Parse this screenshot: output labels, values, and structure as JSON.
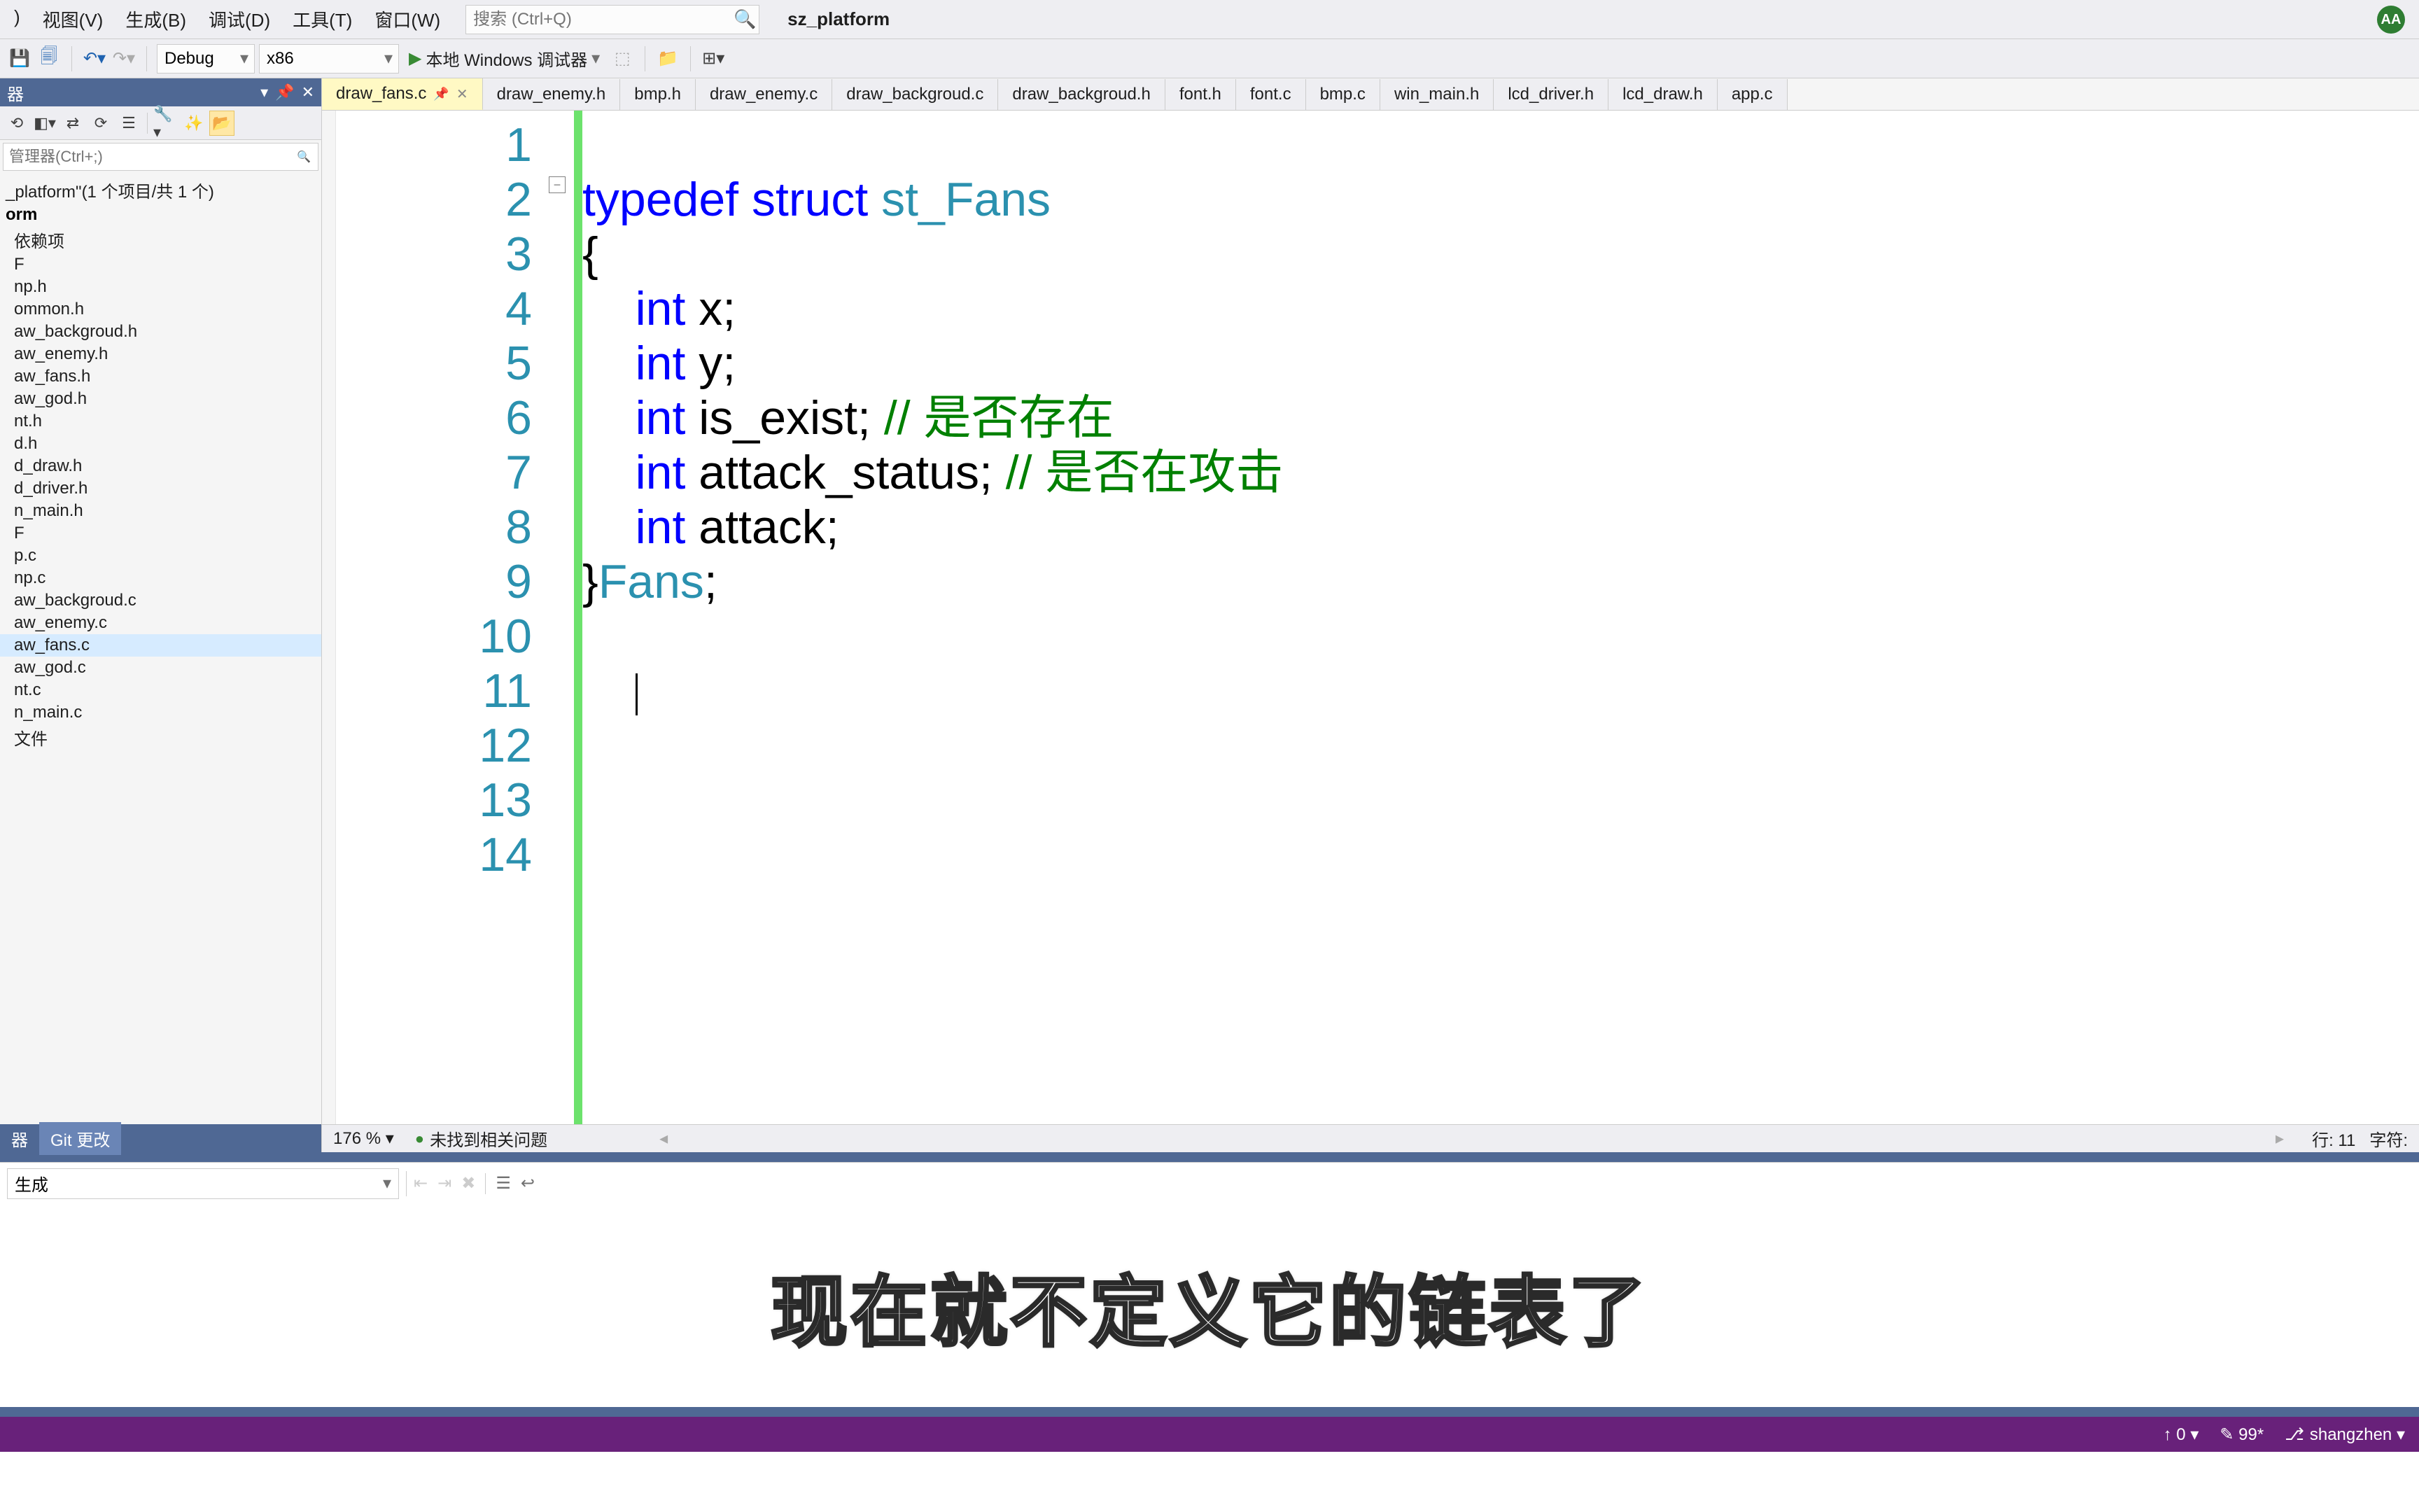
{
  "menubar": {
    "items": [
      ")",
      "视图(V)",
      "生成(B)",
      "调试(D)",
      "工具(T)",
      "窗口(W)"
    ],
    "search_placeholder": "搜索 (Ctrl+Q)",
    "project": "sz_platform",
    "avatar": "AA"
  },
  "toolbar": {
    "config": "Debug",
    "platform": "x86",
    "debugger": "本地 Windows 调试器"
  },
  "sidebar": {
    "header_title": "器",
    "search_placeholder": "管理器(Ctrl+;)",
    "solution": "_platform\"(1 个项目/共 1 个)",
    "project_bold": "orm",
    "items": [
      "依赖项",
      "F",
      "np.h",
      "ommon.h",
      "aw_backgroud.h",
      "aw_enemy.h",
      "aw_fans.h",
      "aw_god.h",
      "nt.h",
      "d.h",
      "d_draw.h",
      "d_driver.h",
      "n_main.h",
      "F",
      "p.c",
      "np.c",
      "aw_backgroud.c",
      "aw_enemy.c",
      "aw_fans.c",
      "aw_god.c",
      "nt.c",
      "n_main.c",
      "文件"
    ],
    "selected_index": 18,
    "bottom_tabs": [
      "器",
      "Git 更改"
    ]
  },
  "tabs": [
    {
      "label": "draw_fans.c",
      "active": true
    },
    {
      "label": "draw_enemy.h",
      "active": false
    },
    {
      "label": "bmp.h",
      "active": false
    },
    {
      "label": "draw_enemy.c",
      "active": false
    },
    {
      "label": "draw_backgroud.c",
      "active": false
    },
    {
      "label": "draw_backgroud.h",
      "active": false
    },
    {
      "label": "font.h",
      "active": false
    },
    {
      "label": "font.c",
      "active": false
    },
    {
      "label": "bmp.c",
      "active": false
    },
    {
      "label": "win_main.h",
      "active": false
    },
    {
      "label": "lcd_driver.h",
      "active": false
    },
    {
      "label": "lcd_draw.h",
      "active": false
    },
    {
      "label": "app.c",
      "active": false
    }
  ],
  "code": {
    "line_count": 14,
    "cursor_line": 11,
    "lines": [
      {
        "n": 1,
        "html": ""
      },
      {
        "n": 2,
        "html": "<span class='kw'>typedef</span> <span class='kw'>struct</span> <span class='type'>st_Fans</span>"
      },
      {
        "n": 3,
        "html": "{"
      },
      {
        "n": 4,
        "html": "    <span class='kw'>int</span> x;"
      },
      {
        "n": 5,
        "html": "    <span class='kw'>int</span> y;"
      },
      {
        "n": 6,
        "html": "    <span class='kw'>int</span> is_exist; <span class='comment'>// 是否存在</span>"
      },
      {
        "n": 7,
        "html": "    <span class='kw'>int</span> attack_status; <span class='comment'>// 是否在攻击</span>"
      },
      {
        "n": 8,
        "html": "    <span class='kw'>int</span> attack;"
      },
      {
        "n": 9,
        "html": "}<span class='type'>Fans</span>;"
      },
      {
        "n": 10,
        "html": ""
      },
      {
        "n": 11,
        "html": "    <span class='cursor'></span>"
      },
      {
        "n": 12,
        "html": ""
      },
      {
        "n": 13,
        "html": ""
      },
      {
        "n": 14,
        "html": ""
      }
    ]
  },
  "editor_status": {
    "zoom": "176 %",
    "issues": "未找到相关问题",
    "line": "行: 11",
    "col": "字符:"
  },
  "output": {
    "source": "生成"
  },
  "subtitle": "现在就不定义它的链表了",
  "statusbar": {
    "up": "↑ 0 ▾",
    "pen": "✎ 99*",
    "branch": "shangzhen ▾"
  },
  "chart_data": null
}
